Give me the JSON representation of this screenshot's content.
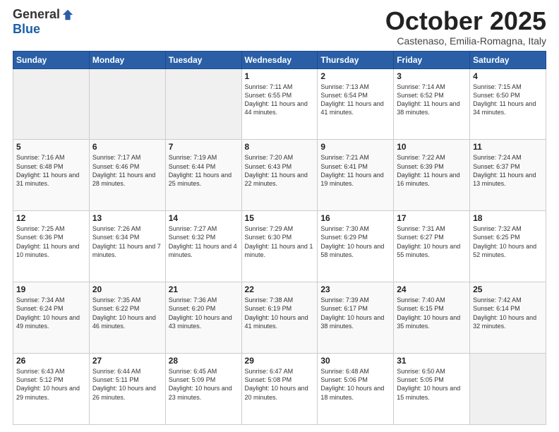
{
  "logo": {
    "general": "General",
    "blue": "Blue"
  },
  "header": {
    "month": "October 2025",
    "location": "Castenaso, Emilia-Romagna, Italy"
  },
  "weekdays": [
    "Sunday",
    "Monday",
    "Tuesday",
    "Wednesday",
    "Thursday",
    "Friday",
    "Saturday"
  ],
  "weeks": [
    [
      {
        "day": "",
        "info": ""
      },
      {
        "day": "",
        "info": ""
      },
      {
        "day": "",
        "info": ""
      },
      {
        "day": "1",
        "info": "Sunrise: 7:11 AM\nSunset: 6:55 PM\nDaylight: 11 hours and 44 minutes."
      },
      {
        "day": "2",
        "info": "Sunrise: 7:13 AM\nSunset: 6:54 PM\nDaylight: 11 hours and 41 minutes."
      },
      {
        "day": "3",
        "info": "Sunrise: 7:14 AM\nSunset: 6:52 PM\nDaylight: 11 hours and 38 minutes."
      },
      {
        "day": "4",
        "info": "Sunrise: 7:15 AM\nSunset: 6:50 PM\nDaylight: 11 hours and 34 minutes."
      }
    ],
    [
      {
        "day": "5",
        "info": "Sunrise: 7:16 AM\nSunset: 6:48 PM\nDaylight: 11 hours and 31 minutes."
      },
      {
        "day": "6",
        "info": "Sunrise: 7:17 AM\nSunset: 6:46 PM\nDaylight: 11 hours and 28 minutes."
      },
      {
        "day": "7",
        "info": "Sunrise: 7:19 AM\nSunset: 6:44 PM\nDaylight: 11 hours and 25 minutes."
      },
      {
        "day": "8",
        "info": "Sunrise: 7:20 AM\nSunset: 6:43 PM\nDaylight: 11 hours and 22 minutes."
      },
      {
        "day": "9",
        "info": "Sunrise: 7:21 AM\nSunset: 6:41 PM\nDaylight: 11 hours and 19 minutes."
      },
      {
        "day": "10",
        "info": "Sunrise: 7:22 AM\nSunset: 6:39 PM\nDaylight: 11 hours and 16 minutes."
      },
      {
        "day": "11",
        "info": "Sunrise: 7:24 AM\nSunset: 6:37 PM\nDaylight: 11 hours and 13 minutes."
      }
    ],
    [
      {
        "day": "12",
        "info": "Sunrise: 7:25 AM\nSunset: 6:36 PM\nDaylight: 11 hours and 10 minutes."
      },
      {
        "day": "13",
        "info": "Sunrise: 7:26 AM\nSunset: 6:34 PM\nDaylight: 11 hours and 7 minutes."
      },
      {
        "day": "14",
        "info": "Sunrise: 7:27 AM\nSunset: 6:32 PM\nDaylight: 11 hours and 4 minutes."
      },
      {
        "day": "15",
        "info": "Sunrise: 7:29 AM\nSunset: 6:30 PM\nDaylight: 11 hours and 1 minute."
      },
      {
        "day": "16",
        "info": "Sunrise: 7:30 AM\nSunset: 6:29 PM\nDaylight: 10 hours and 58 minutes."
      },
      {
        "day": "17",
        "info": "Sunrise: 7:31 AM\nSunset: 6:27 PM\nDaylight: 10 hours and 55 minutes."
      },
      {
        "day": "18",
        "info": "Sunrise: 7:32 AM\nSunset: 6:25 PM\nDaylight: 10 hours and 52 minutes."
      }
    ],
    [
      {
        "day": "19",
        "info": "Sunrise: 7:34 AM\nSunset: 6:24 PM\nDaylight: 10 hours and 49 minutes."
      },
      {
        "day": "20",
        "info": "Sunrise: 7:35 AM\nSunset: 6:22 PM\nDaylight: 10 hours and 46 minutes."
      },
      {
        "day": "21",
        "info": "Sunrise: 7:36 AM\nSunset: 6:20 PM\nDaylight: 10 hours and 43 minutes."
      },
      {
        "day": "22",
        "info": "Sunrise: 7:38 AM\nSunset: 6:19 PM\nDaylight: 10 hours and 41 minutes."
      },
      {
        "day": "23",
        "info": "Sunrise: 7:39 AM\nSunset: 6:17 PM\nDaylight: 10 hours and 38 minutes."
      },
      {
        "day": "24",
        "info": "Sunrise: 7:40 AM\nSunset: 6:15 PM\nDaylight: 10 hours and 35 minutes."
      },
      {
        "day": "25",
        "info": "Sunrise: 7:42 AM\nSunset: 6:14 PM\nDaylight: 10 hours and 32 minutes."
      }
    ],
    [
      {
        "day": "26",
        "info": "Sunrise: 6:43 AM\nSunset: 5:12 PM\nDaylight: 10 hours and 29 minutes."
      },
      {
        "day": "27",
        "info": "Sunrise: 6:44 AM\nSunset: 5:11 PM\nDaylight: 10 hours and 26 minutes."
      },
      {
        "day": "28",
        "info": "Sunrise: 6:45 AM\nSunset: 5:09 PM\nDaylight: 10 hours and 23 minutes."
      },
      {
        "day": "29",
        "info": "Sunrise: 6:47 AM\nSunset: 5:08 PM\nDaylight: 10 hours and 20 minutes."
      },
      {
        "day": "30",
        "info": "Sunrise: 6:48 AM\nSunset: 5:06 PM\nDaylight: 10 hours and 18 minutes."
      },
      {
        "day": "31",
        "info": "Sunrise: 6:50 AM\nSunset: 5:05 PM\nDaylight: 10 hours and 15 minutes."
      },
      {
        "day": "",
        "info": ""
      }
    ]
  ]
}
